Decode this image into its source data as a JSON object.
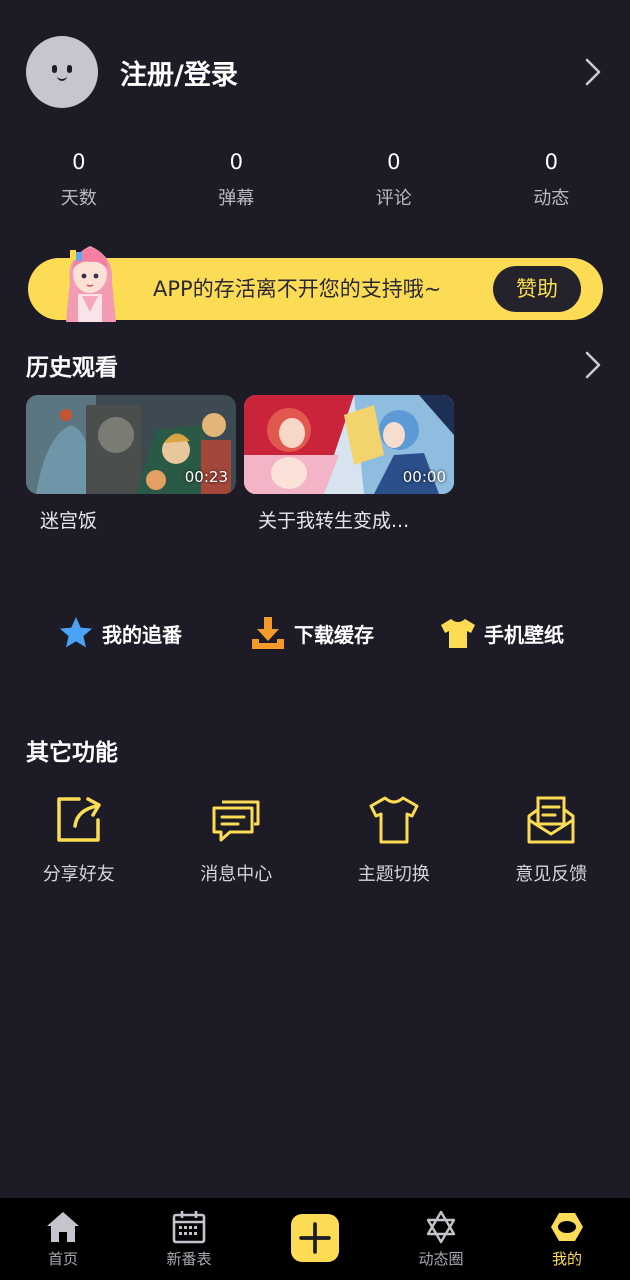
{
  "profile": {
    "login_label": "注册/登录"
  },
  "stats": [
    {
      "value": "0",
      "label": "天数"
    },
    {
      "value": "0",
      "label": "弹幕"
    },
    {
      "value": "0",
      "label": "评论"
    },
    {
      "value": "0",
      "label": "动态"
    }
  ],
  "banner": {
    "text": "APP的存活离不开您的支持哦~",
    "button": "赞助"
  },
  "history": {
    "title": "历史观看",
    "items": [
      {
        "title": "迷宫饭",
        "duration": "00:23"
      },
      {
        "title": "关于我转生变成...",
        "duration": "00:00"
      }
    ]
  },
  "quick_actions": [
    {
      "label": "我的追番",
      "icon": "star-icon"
    },
    {
      "label": "下载缓存",
      "icon": "download-icon"
    },
    {
      "label": "手机壁纸",
      "icon": "tshirt-icon"
    }
  ],
  "other": {
    "title": "其它功能",
    "items": [
      {
        "label": "分享好友",
        "icon": "share-icon"
      },
      {
        "label": "消息中心",
        "icon": "message-icon"
      },
      {
        "label": "主题切换",
        "icon": "theme-icon"
      },
      {
        "label": "意见反馈",
        "icon": "feedback-icon"
      }
    ]
  },
  "nav": [
    {
      "label": "首页",
      "icon": "home-icon"
    },
    {
      "label": "新番表",
      "icon": "calendar-icon"
    },
    {
      "label": "",
      "icon": "plus-icon"
    },
    {
      "label": "动态圈",
      "icon": "hexagram-icon"
    },
    {
      "label": "我的",
      "icon": "profile-hex-icon"
    }
  ],
  "colors": {
    "background": "#1d1b25",
    "accent": "#fbdc54",
    "nav_bg": "#000000",
    "blue_star": "#4aa3f5",
    "orange_download": "#f39a2b"
  }
}
